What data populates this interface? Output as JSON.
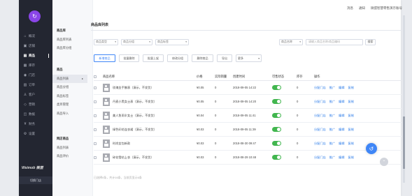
{
  "topbar": {
    "items": [
      "消息",
      "通知",
      "微盟智慧零售演示账号"
    ]
  },
  "sidebar": {
    "logo_glyph": "↻",
    "items": [
      {
        "label": "概况",
        "icon": "grid-icon",
        "glyph": "⌂"
      },
      {
        "label": "店铺",
        "icon": "store-icon",
        "glyph": "▣"
      },
      {
        "label": "商品",
        "icon": "goods-icon",
        "glyph": "▤"
      },
      {
        "label": "库存",
        "icon": "inventory-icon",
        "glyph": "▦"
      },
      {
        "label": "门店",
        "icon": "location-icon",
        "glyph": "◉"
      },
      {
        "label": "订单",
        "icon": "order-icon",
        "glyph": "▥"
      },
      {
        "label": "客户",
        "icon": "customer-icon",
        "glyph": "♙"
      },
      {
        "label": "营销",
        "icon": "marketing-icon",
        "glyph": "◇"
      },
      {
        "label": "数据",
        "icon": "data-icon",
        "glyph": "◫"
      },
      {
        "label": "财务",
        "icon": "finance-icon",
        "glyph": "¥"
      },
      {
        "label": "设置",
        "icon": "settings-icon",
        "glyph": "⚙"
      }
    ],
    "brand": "Weimob 微盟",
    "store_link": "切换门店"
  },
  "subnav": {
    "section1": [
      "商品库",
      "商品库列表",
      "商品库分组"
    ],
    "section2": [
      "商品",
      "商品列表",
      "商品分组",
      "商品标签",
      "类目管理",
      "商品导入"
    ],
    "section3": [
      "网店商品",
      "商品列表",
      "商品评价"
    ]
  },
  "page": {
    "title": "商品库列表"
  },
  "filters": {
    "select1": "商品类型",
    "select2": "商品分组",
    "select3": "商品标签",
    "select4": "商品名称",
    "search_placeholder": "请输入商品名称/商品编码",
    "search_button": "搜索"
  },
  "actions": [
    "新增商品",
    "批量删除",
    "批量上架",
    "修改分组",
    "删除商品",
    "导出",
    "更多"
  ],
  "table": {
    "headers": [
      "商品名称",
      "价格",
      "实际销量",
      "创建时间",
      "可售状态",
      "库存",
      "操作"
    ],
    "rows": [
      {
        "name": "玫瑰金手腕表（演示，不发货）",
        "price": "¥0.05",
        "sales": "0",
        "created": "2018-09-05 14:22",
        "stock": "0"
      },
      {
        "name": "丹麦小黑女士表（演示，不发货）",
        "price": "¥0.05",
        "sales": "0",
        "created": "2018-09-05 14:20",
        "stock": "0"
      },
      {
        "name": "美人鱼雨伞女士（演示，不发货）",
        "price": "¥0.04",
        "sales": "0",
        "created": "2018-09-05 11:41",
        "stock": "0"
      },
      {
        "name": "绿色印花连衣裙（演示，不发货）",
        "price": "¥0.03",
        "sales": "0",
        "created": "2018-09-05 11:39",
        "stock": "0"
      },
      {
        "name": "时尚女包新款",
        "price": "¥0.03",
        "sales": "0",
        "created": "2018-08-30 09:47",
        "stock": "0"
      },
      {
        "name": "碎花雪纺上衣（演示，不发货）",
        "price": "¥0.03",
        "sales": "0",
        "created": "2018-08-29 10:48",
        "stock": "0"
      }
    ],
    "row_actions": [
      "分配门店",
      "推广",
      "编辑",
      "复制"
    ]
  },
  "footer": {
    "text": "已选择0条，共计16条，当前页显示6条"
  }
}
